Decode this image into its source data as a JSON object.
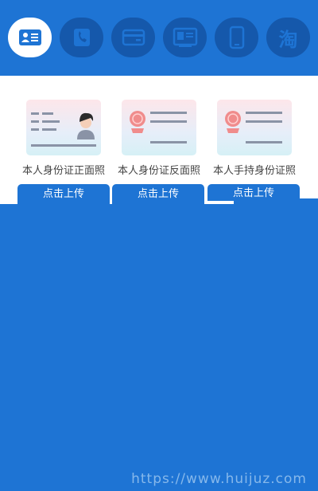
{
  "tabs": [
    {
      "icon": "id-card-icon",
      "active": true
    },
    {
      "icon": "phone-book-icon",
      "active": false
    },
    {
      "icon": "bank-card-icon",
      "active": false
    },
    {
      "icon": "license-icon",
      "active": false
    },
    {
      "icon": "mobile-phone-icon",
      "active": false
    },
    {
      "icon": "taobao-icon",
      "label": "淘",
      "active": false
    }
  ],
  "cards": [
    {
      "caption": "本人身份证正面照",
      "button": "点击上传",
      "icon": "id-front-illustration"
    },
    {
      "caption": "本人身份证反面照",
      "button": "点击上传",
      "icon": "id-back-illustration"
    },
    {
      "caption": "本人手持身份证照",
      "button": "点击上传",
      "icon": "id-handheld-illustration"
    }
  ],
  "watermark": "https://www.huijuz.com",
  "colors": {
    "primary": "#1e74d4",
    "tab_inactive": "#1558ab",
    "card_gray": "#8a93a6",
    "seal_red": "#f08c8c"
  }
}
